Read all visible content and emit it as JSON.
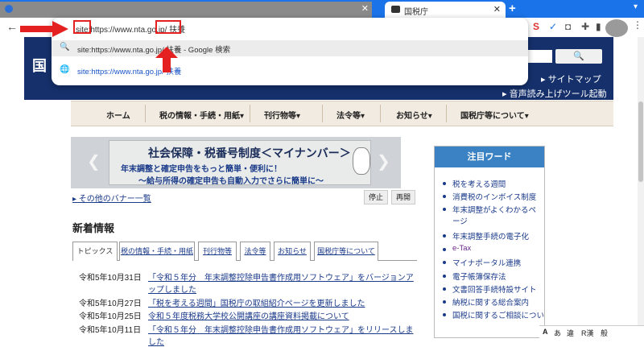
{
  "browser": {
    "tab_title": "国税庁",
    "omnibox_value": "site:https://www.nta.go.jp/ 扶養",
    "suggestions": [
      {
        "text": "site:https://www.nta.go.jp/ 扶養 - Google 検索",
        "icon": "search-icon"
      },
      {
        "text": "site:https://www.nta.go.jp/ 扶養",
        "icon": "globe-icon"
      }
    ],
    "annotation_color": "#e52020"
  },
  "header": {
    "logo": "国",
    "search_button": "🔍",
    "links": [
      "る",
      "▸ サイトマップ"
    ],
    "audio_link": "▸ 音声読み上げツール起動"
  },
  "gnav": [
    "ホーム",
    "税の情報・手続・用紙▾",
    "刊行物等▾",
    "法令等▾",
    "お知らせ▾",
    "国税庁等について▾"
  ],
  "banner": {
    "title": "社会保障・税番号制度＜マイナンバー＞",
    "line1": "年末調整と確定申告をもっと簡単・便利に！",
    "line2": "〜給与所得の確定申告も自動入力でさらに簡単に〜",
    "more": "▸ その他のバナー一覧",
    "stop": "停止",
    "play": "再開"
  },
  "news": {
    "heading": "新着情報",
    "tabs": [
      "トピックス",
      "税の情報・手続・用紙",
      "刊行物等",
      "法令等",
      "お知らせ",
      "国税庁等について"
    ],
    "items": [
      {
        "date": "令和5年10月31日",
        "title": "「令和５年分　年末調整控除申告書作成用ソフトウェア」をバージョンアップしました"
      },
      {
        "date": "令和5年10月27日",
        "title": "「税を考える週間」国税庁の取組紹介ページを更新しました"
      },
      {
        "date": "令和5年10月25日",
        "title": "令和５年度税務大学校公開講座の講座資料掲載について"
      },
      {
        "date": "令和5年10月11日",
        "title": "「令和５年分　年末調整控除申告書作成用ソフトウェア」をリリースしました"
      }
    ]
  },
  "sidebar": {
    "heading": "注目ワード",
    "items": [
      "税を考える週間",
      "消費税のインボイス制度",
      "年末調整がよくわかるページ",
      "年末調整手続の電子化",
      "e-Tax",
      "マイナポータル連携",
      "電子帳簿保存法",
      "文書回答手続特設サイト",
      "納税に関する総合案内",
      "国税に関するご相談につい"
    ]
  },
  "ime": [
    "A",
    "あ",
    "違",
    "R漢",
    "般"
  ]
}
